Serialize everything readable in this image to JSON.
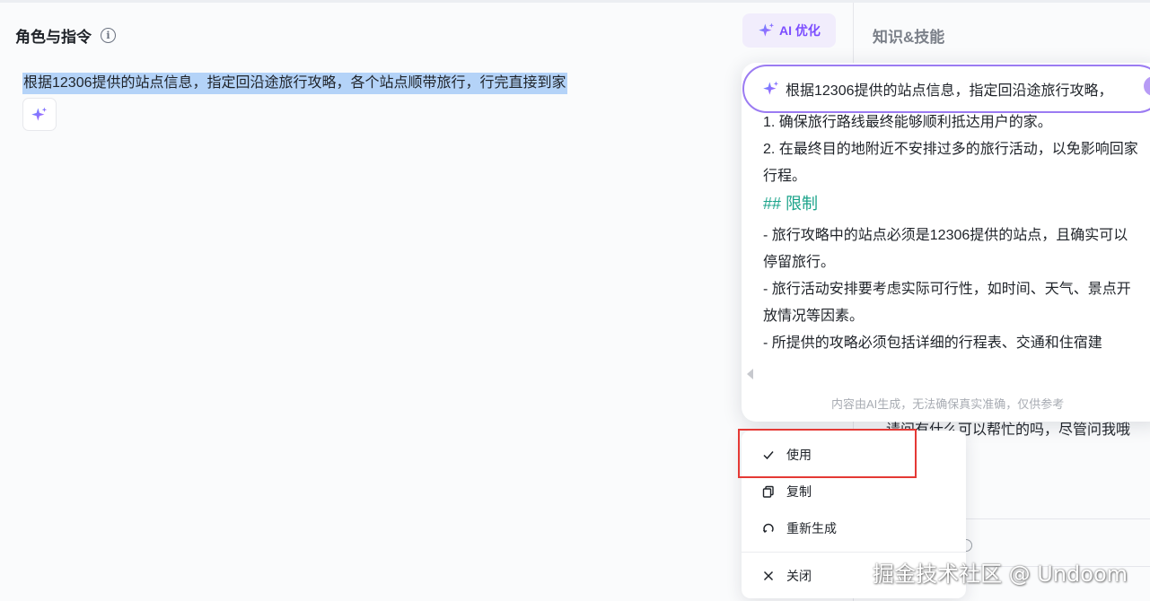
{
  "editor": {
    "section_title": "角色与指令",
    "prompt_text": "根据12306提供的站点信息，指定回沿途旅行攻略，各个站点顺带旅行，行完直接到家",
    "ai_optimize_label": "AI 优化"
  },
  "right_panel": {
    "title": "知识&技能",
    "chat_text_partial": "请问有什么可以帮忙的吗，尽管问我哦"
  },
  "ai_popup": {
    "query_text": "根据12306提供的站点信息，指定回沿途旅行攻略，",
    "content": [
      "1. 确保旅行路线最终能够顺利抵达用户的家。",
      "2. 在最终目的地附近不安排过多的旅行活动，以免影响回家行程。",
      "## 限制",
      "- 旅行攻略中的站点必须是12306提供的站点，且确实可以停留旅行。",
      "- 旅行活动安排要考虑实际可行性，如时间、天气、景点开放情况等因素。",
      "- 所提供的攻略必须包括详细的行程表、交通和住宿建"
    ],
    "disclaimer": "内容由AI生成，无法确保真实准确，仅供参考"
  },
  "action_menu": {
    "use": "使用",
    "copy": "复制",
    "regenerate": "重新生成",
    "close": "关闭"
  },
  "watermark": "掘金技术社区 @ Undoom",
  "colors": {
    "accent": "#7c4dff",
    "heading_green": "#1aa38a",
    "selection": "#b4d3f8",
    "highlight_red": "#e53935"
  }
}
